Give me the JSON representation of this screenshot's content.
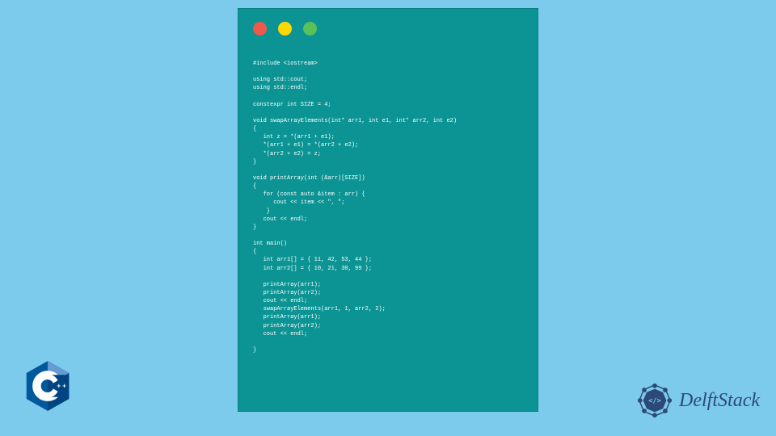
{
  "code": {
    "content": "#include <iostream>\n\nusing std::cout;\nusing std::endl;\n\nconstexpr int SIZE = 4;\n\nvoid swapArrayElements(int* arr1, int e1, int* arr2, int e2)\n{\n   int z = *(arr1 + e1);\n   *(arr1 + e1) = *(arr2 + e2);\n   *(arr2 + e2) = z;\n}\n\nvoid printArray(int (&arr)[SIZE])\n{\n   for (const auto &item : arr) {\n      cout << item << \", \";\n    }\n   cout << endl;\n}\n\nint main()\n{\n   int arr1[] = { 11, 42, 53, 44 };\n   int arr2[] = { 10, 21, 30, 99 };\n\n   printArray(arr1);\n   printArray(arr2);\n   cout << endl;\n   swapArrayElements(arr1, 1, arr2, 2);\n   printArray(arr1);\n   printArray(arr2);\n   cout << endl;\n\n}"
  },
  "branding": {
    "delftstack_label": "DelftStack",
    "cpp_label": "C++"
  },
  "colors": {
    "page_bg": "#7ccaec",
    "window_bg": "#0c9494",
    "dot_red": "#ed594a",
    "dot_yellow": "#fdd800",
    "dot_green": "#5ac05a",
    "brand_blue": "#2b4a7a"
  }
}
